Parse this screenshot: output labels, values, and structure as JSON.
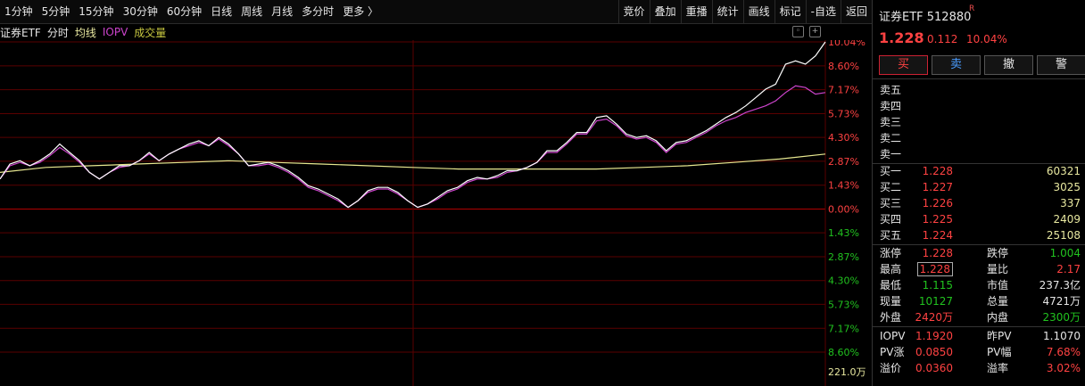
{
  "toolbar": {
    "periods": [
      "1分钟",
      "5分钟",
      "15分钟",
      "30分钟",
      "60分钟",
      "日线",
      "周线",
      "月线",
      "多分时",
      "更多 〉"
    ],
    "tools": [
      "竞价",
      "叠加",
      "重播",
      "统计",
      "画线",
      "标记",
      "-自选",
      "返回"
    ]
  },
  "legend": {
    "name": "证券ETF",
    "intraday": "分时",
    "avg": "均线",
    "iopv": "IOPV",
    "vol": "成交量"
  },
  "colors": {
    "up": "#ff4242",
    "down": "#21c21f",
    "price_line": "#ffffff",
    "avg_line": "#e8e890",
    "iopv_line": "#cc44cc",
    "grid": "#5a0000"
  },
  "axis": {
    "pct_labels": [
      "10.04%",
      "8.60%",
      "7.17%",
      "5.73%",
      "4.30%",
      "2.87%",
      "1.43%",
      "0.00%",
      "1.43%",
      "2.87%",
      "4.30%",
      "5.73%",
      "7.17%",
      "8.60%"
    ],
    "vol_label": "221.0万"
  },
  "panel": {
    "name": "证券ETF 512880",
    "r_tag": "R",
    "price": "1.228",
    "change": "0.112",
    "pct": "10.04%",
    "buttons": {
      "buy": "买",
      "sell": "卖",
      "cancel": "撤",
      "alert": "警"
    },
    "asks": [
      {
        "label": "卖五",
        "price": "",
        "vol": ""
      },
      {
        "label": "卖四",
        "price": "",
        "vol": ""
      },
      {
        "label": "卖三",
        "price": "",
        "vol": ""
      },
      {
        "label": "卖二",
        "price": "",
        "vol": ""
      },
      {
        "label": "卖一",
        "price": "",
        "vol": ""
      }
    ],
    "bids": [
      {
        "label": "买一",
        "price": "1.228",
        "vol": "60321"
      },
      {
        "label": "买二",
        "price": "1.227",
        "vol": "3025"
      },
      {
        "label": "买三",
        "price": "1.226",
        "vol": "337"
      },
      {
        "label": "买四",
        "price": "1.225",
        "vol": "2409"
      },
      {
        "label": "买五",
        "price": "1.224",
        "vol": "25108"
      }
    ],
    "stats": [
      {
        "l1": "涨停",
        "v1": "1.228",
        "c1": "red",
        "l2": "跌停",
        "v2": "1.004",
        "c2": "green"
      },
      {
        "l1": "最高",
        "v1": "1.228",
        "c1": "red",
        "l2": "量比",
        "v2": "2.17",
        "c2": "red"
      },
      {
        "l1": "最低",
        "v1": "1.115",
        "c1": "green",
        "l2": "市值",
        "v2": "237.3亿",
        "c2": "white"
      },
      {
        "l1": "现量",
        "v1": "10127",
        "c1": "green",
        "l2": "总量",
        "v2": "4721万",
        "c2": "white"
      },
      {
        "l1": "外盘",
        "v1": "2420万",
        "c1": "red",
        "l2": "内盘",
        "v2": "2300万",
        "c2": "green"
      }
    ],
    "iopv": [
      {
        "l1": "IOPV",
        "v1": "1.1920",
        "c1": "red",
        "l2": "昨PV",
        "v2": "1.1070",
        "c2": "white"
      },
      {
        "l1": "PV涨",
        "v1": "0.0850",
        "c1": "red",
        "l2": "PV幅",
        "v2": "7.68%",
        "c2": "red"
      },
      {
        "l1": "溢价",
        "v1": "0.0360",
        "c1": "red",
        "l2": "溢率",
        "v2": "3.02%",
        "c2": "red"
      }
    ]
  },
  "chart_data": {
    "type": "line",
    "series": [
      {
        "name": "证券ETF",
        "values": [
          1.8,
          2.7,
          2.9,
          2.6,
          2.9,
          3.3,
          3.9,
          3.4,
          2.9,
          2.2,
          1.8,
          2.2,
          2.6,
          2.6,
          2.9,
          3.4,
          2.9,
          3.3,
          3.6,
          3.9,
          4.1,
          3.8,
          4.3,
          3.9,
          3.3,
          2.6,
          2.7,
          2.8,
          2.6,
          2.3,
          1.9,
          1.4,
          1.2,
          0.9,
          0.6,
          0.1,
          0.5,
          1.1,
          1.3,
          1.3,
          1.0,
          0.5,
          0.1,
          0.3,
          0.7,
          1.1,
          1.3,
          1.7,
          1.9,
          1.8,
          2.0,
          2.3,
          2.3,
          2.5,
          2.8,
          3.5,
          3.5,
          4.0,
          4.6,
          4.6,
          5.5,
          5.6,
          5.1,
          4.5,
          4.3,
          4.4,
          4.1,
          3.5,
          4.0,
          4.1,
          4.4,
          4.7,
          5.1,
          5.5,
          5.8,
          6.2,
          6.7,
          7.2,
          7.5,
          8.7,
          8.9,
          8.7,
          9.2,
          10.04
        ]
      },
      {
        "name": "IOPV",
        "values": [
          1.8,
          2.6,
          2.8,
          2.6,
          2.8,
          3.2,
          3.7,
          3.3,
          2.8,
          2.2,
          1.8,
          2.2,
          2.5,
          2.6,
          2.9,
          3.3,
          2.9,
          3.3,
          3.6,
          3.8,
          4.0,
          3.8,
          4.2,
          3.8,
          3.3,
          2.6,
          2.6,
          2.7,
          2.5,
          2.2,
          1.8,
          1.3,
          1.1,
          0.8,
          0.5,
          0.1,
          0.5,
          1.0,
          1.2,
          1.2,
          0.9,
          0.5,
          0.1,
          0.3,
          0.6,
          1.0,
          1.2,
          1.6,
          1.8,
          1.8,
          1.9,
          2.2,
          2.3,
          2.5,
          2.8,
          3.4,
          3.4,
          3.9,
          4.5,
          4.5,
          5.3,
          5.4,
          5.0,
          4.4,
          4.2,
          4.3,
          4.0,
          3.4,
          3.9,
          4.0,
          4.3,
          4.6,
          5.0,
          5.3,
          5.5,
          5.8,
          6.0,
          6.2,
          6.5,
          7.0,
          7.4,
          7.3,
          6.9,
          7.0
        ]
      },
      {
        "name": "均线",
        "values": [
          2.2,
          2.5,
          2.6,
          2.7,
          2.8,
          2.9,
          2.8,
          2.7,
          2.6,
          2.5,
          2.4,
          2.4,
          2.4,
          2.4,
          2.5,
          2.6,
          2.8,
          3.0,
          3.3
        ]
      }
    ],
    "ylim": [
      -8.6,
      10.04
    ]
  }
}
